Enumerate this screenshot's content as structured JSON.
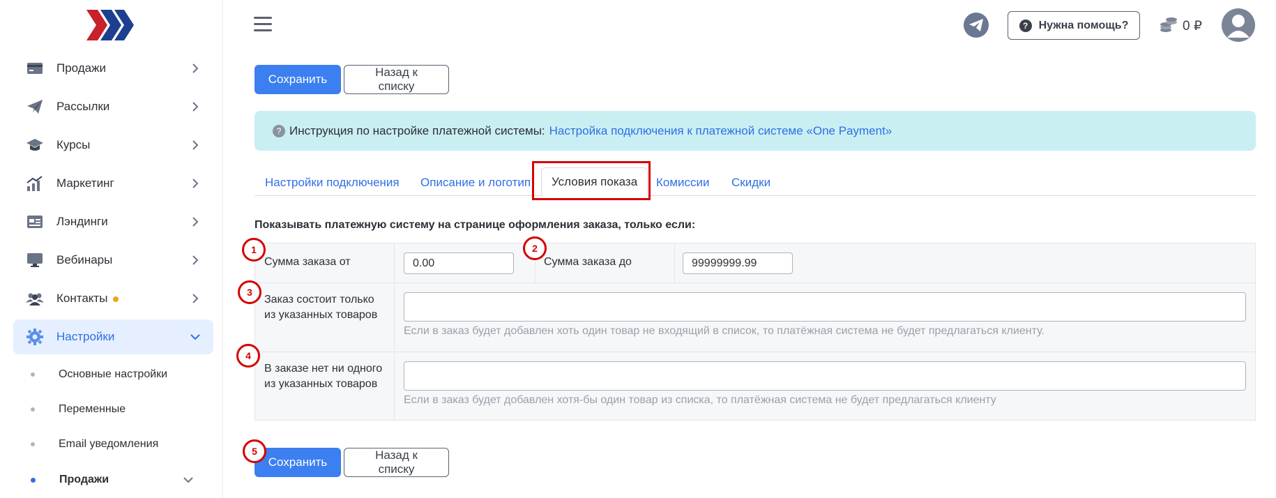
{
  "sidebar": {
    "items": [
      {
        "label": "Продажи",
        "icon": "card-icon"
      },
      {
        "label": "Рассылки",
        "icon": "paper-plane-icon"
      },
      {
        "label": "Курсы",
        "icon": "graduation-cap-icon"
      },
      {
        "label": "Маркетинг",
        "icon": "chart-up-icon"
      },
      {
        "label": "Лэндинги",
        "icon": "landing-page-icon"
      },
      {
        "label": "Вебинары",
        "icon": "monitor-icon"
      },
      {
        "label": "Контакты",
        "icon": "users-icon"
      },
      {
        "label": "Настройки",
        "icon": "gear-icon"
      }
    ],
    "subitems": [
      {
        "label": "Основные настройки"
      },
      {
        "label": "Переменные"
      },
      {
        "label": "Email уведомления"
      },
      {
        "label": "Продажи"
      }
    ]
  },
  "header": {
    "help_label": "Нужна помощь?",
    "balance": "0 ₽"
  },
  "toolbar": {
    "save_label": "Сохранить",
    "back_label": "Назад к списку"
  },
  "banner": {
    "prefix": "Инструкция по настройке платежной системы:",
    "link": "Настройка подключения к платежной системе «One Payment»"
  },
  "tabs": [
    {
      "label": "Настройки подключения"
    },
    {
      "label": "Описание и логотип"
    },
    {
      "label": "Условия показа"
    },
    {
      "label": "Комиссии"
    },
    {
      "label": "Скидки"
    }
  ],
  "section_title": "Показывать платежную систему на странице оформления заказа, только если:",
  "conditions": {
    "sum_from_label": "Сумма заказа от",
    "sum_from_value": "0.00",
    "sum_to_label": "Сумма заказа до",
    "sum_to_value": "99999999.99",
    "only_products_label": "Заказ состоит только из указанных товаров",
    "only_products_hint": "Если в заказ будет добавлен хоть один товар не входящий в список, то платёжная система не будет предлагаться клиенту.",
    "no_products_label": "В заказе нет ни одного из указанных товаров",
    "no_products_hint": "Если в заказ будет добавлен хотя-бы один товар из списка, то платёжная система не будет предлагаться клиенту"
  },
  "markers": [
    "1",
    "2",
    "3",
    "4",
    "5"
  ],
  "colors": {
    "accent": "#3b7ff0",
    "annotation_red": "#d60000",
    "banner_bg": "#c9eff3"
  }
}
